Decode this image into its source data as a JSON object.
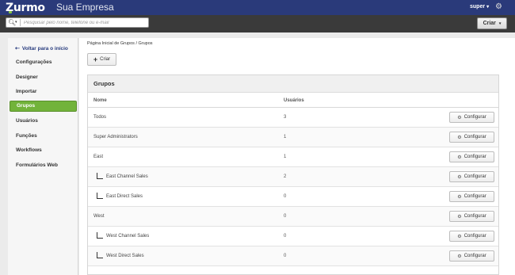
{
  "header": {
    "logo_text": "Zurmo",
    "company_name": "Sua Empresa",
    "user_label": "super",
    "user_caret": "▾",
    "settings_icon": "gear-icon",
    "brand_color": "#2a3a7a"
  },
  "search": {
    "placeholder": "Pesquisar pelo nome, telefone ou e-mail",
    "icon": "search-icon",
    "create_label": "Criar",
    "create_caret": "▾"
  },
  "sidebar": {
    "back_label": "Voltar para o início",
    "items": [
      {
        "label": "Configurações",
        "active": false
      },
      {
        "label": "Designer",
        "active": false
      },
      {
        "label": "Importar",
        "active": false
      },
      {
        "label": "Grupos",
        "active": true
      },
      {
        "label": "Usuários",
        "active": false
      },
      {
        "label": "Funções",
        "active": false
      },
      {
        "label": "Workflows",
        "active": false
      },
      {
        "label": "Formulários Web",
        "active": false
      }
    ],
    "active_color": "#72b33a"
  },
  "main": {
    "breadcrumb": "Página Inicial de Grupos / Grupos",
    "add_label": "Criar",
    "panel_title": "Grupos",
    "columns": {
      "name": "Nome",
      "users": "Usuários"
    },
    "configure_label": "Configurar",
    "rows": [
      {
        "name": "Todos",
        "users": "3",
        "indent": 0
      },
      {
        "name": "Super Administrators",
        "users": "1",
        "indent": 0
      },
      {
        "name": "East",
        "users": "1",
        "indent": 0
      },
      {
        "name": "East Channel Sales",
        "users": "2",
        "indent": 1
      },
      {
        "name": "East Direct Sales",
        "users": "0",
        "indent": 1
      },
      {
        "name": "West",
        "users": "0",
        "indent": 0
      },
      {
        "name": "West Channel Sales",
        "users": "0",
        "indent": 1
      },
      {
        "name": "West Direct Sales",
        "users": "0",
        "indent": 1
      }
    ]
  }
}
